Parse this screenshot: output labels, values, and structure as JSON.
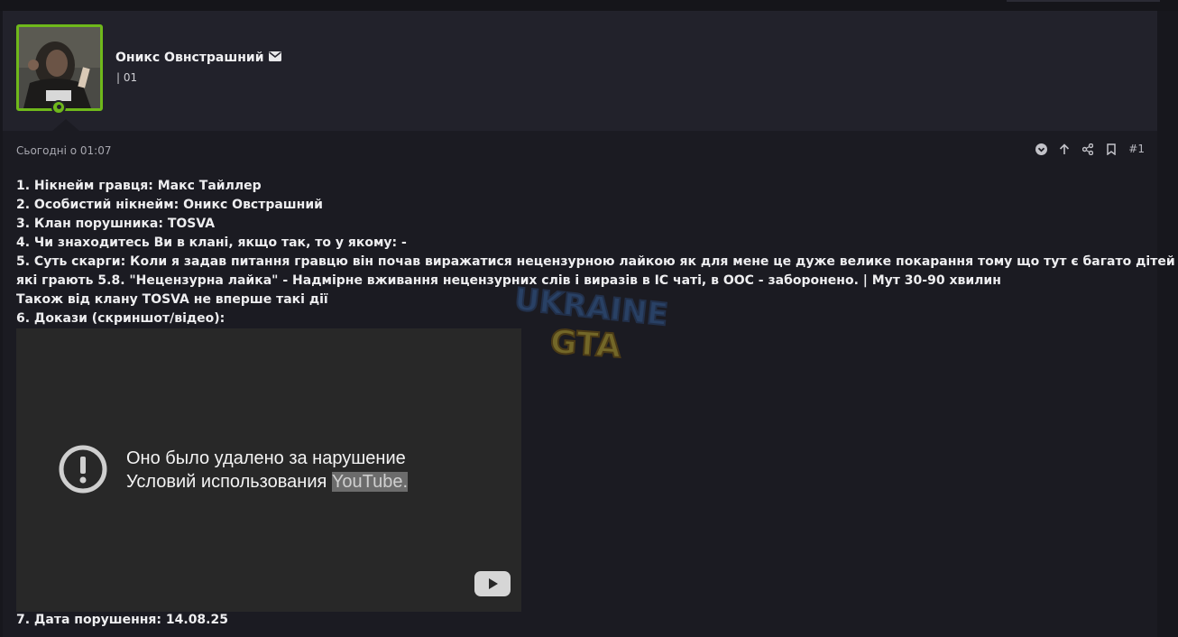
{
  "author": {
    "name": "Оникс Овнстрашний",
    "title": "| 01",
    "status": "online"
  },
  "post": {
    "date": "Сьогодні о 01:07",
    "number": "#1",
    "lines": [
      "1. Нікнейм гравця: Макс Тайллер",
      "2. Особистий нікнейм: Оникс Овстрашний",
      "3. Клан порушника: TOSVA",
      "4. Чи знаходитесь Ви в клані, якщо так, то у якому: -",
      "5. Суть скарги: Коли я задав питання гравцю він почав виражатися нецензурною лайкою як для мене це дуже велике покарання тому що тут є багато дітей",
      "які грають 5.8. \"Нецензурна лайка\" - Надмірне вживання нецензурних слів і виразів в IC чаті, в ООС - заборонено. | Мут 30-90 хвилин",
      "Також від клану TOSVA не вперше такі дії",
      "6. Докази (скриншот/відео):"
    ],
    "last_line": "7. Дата порушення: 14.08.25"
  },
  "video": {
    "message_line1": "Оно было удалено за нарушение",
    "message_line2": "Условий использования ",
    "message_link": "YouTube."
  },
  "watermark": {
    "line1": "UKRAINE",
    "line2": "GTA"
  },
  "colors": {
    "accent": "#6fb81b",
    "background": "#17171d",
    "panel": "#22222b"
  },
  "icons": [
    "envelope-icon",
    "chevron-down-circle-icon",
    "arrow-up-icon",
    "share-icon",
    "bookmark-icon",
    "warning-icon",
    "youtube-play-icon"
  ]
}
